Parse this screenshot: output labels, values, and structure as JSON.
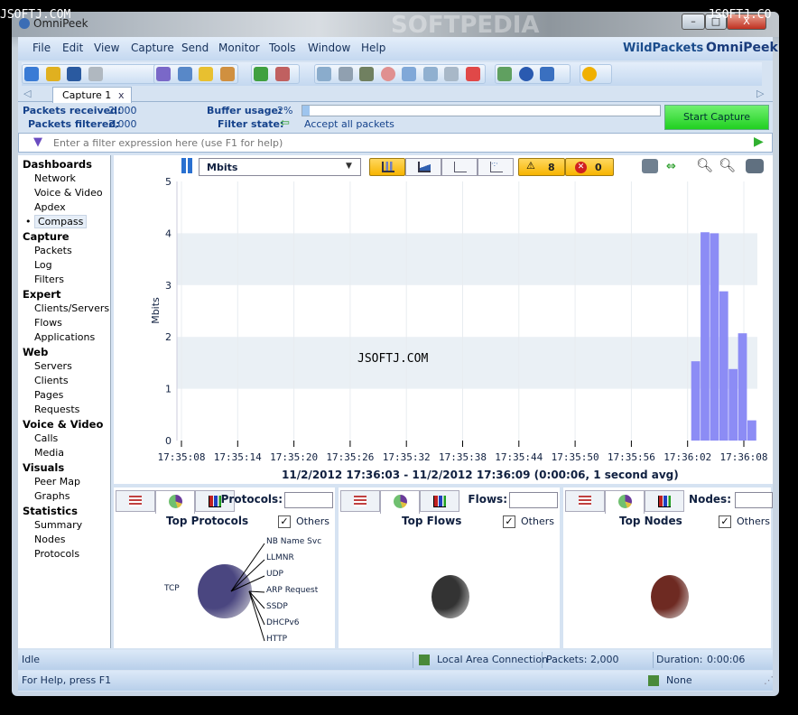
{
  "watermarks": {
    "left": "JSOFTJ.COM",
    "right": "JSOFTJ.CO",
    "center": "JSOFTJ.COM",
    "softpedia": "SOFTPEDIA"
  },
  "window": {
    "title": "OmniPeek",
    "minimize": "–",
    "maximize": "□",
    "close": "X"
  },
  "menu": [
    "File",
    "Edit",
    "View",
    "Capture",
    "Send",
    "Monitor",
    "Tools",
    "Window",
    "Help"
  ],
  "brand": {
    "wild": "WildPackets",
    "omni": "OmniPeek"
  },
  "tab": {
    "label": "Capture 1",
    "close": "x"
  },
  "info": {
    "packets_received_label": "Packets received:",
    "packets_received": "2,000",
    "packets_filtered_label": "Packets filtered:",
    "packets_filtered": "2,000",
    "buffer_usage_label": "Buffer usage:",
    "buffer_usage": "2%",
    "buffer_fraction": 0.02,
    "filter_state_label": "Filter state:",
    "filter_state": "Accept all packets",
    "start_capture": "Start Capture"
  },
  "filter": {
    "placeholder": "Enter a filter expression here (use F1 for help)"
  },
  "sidebar": [
    {
      "header": "Dashboards",
      "items": [
        "Network",
        "Voice & Video",
        "Apdex",
        "Compass"
      ]
    },
    {
      "header": "Capture",
      "items": [
        "Packets",
        "Log",
        "Filters"
      ]
    },
    {
      "header": "Expert",
      "items": [
        "Clients/Servers",
        "Flows",
        "Applications"
      ]
    },
    {
      "header": "Web",
      "items": [
        "Servers",
        "Clients",
        "Pages",
        "Requests"
      ]
    },
    {
      "header": "Voice & Video",
      "items": [
        "Calls",
        "Media"
      ]
    },
    {
      "header": "Visuals",
      "items": [
        "Peer Map",
        "Graphs"
      ]
    },
    {
      "header": "Statistics",
      "items": [
        "Summary",
        "Nodes",
        "Protocols"
      ]
    }
  ],
  "sidebar_selected": "Compass",
  "chart_toolbar": {
    "unit_select": "Mbits",
    "warnings": "8",
    "errors": "0"
  },
  "chart_data": {
    "type": "bar",
    "ylabel": "Mbits",
    "ylim": [
      0,
      5
    ],
    "yticks": [
      "0",
      "1",
      "2",
      "3",
      "4",
      "5"
    ],
    "xticks": [
      "17:35:08",
      "17:35:14",
      "17:35:20",
      "17:35:26",
      "17:35:32",
      "17:35:38",
      "17:35:44",
      "17:35:50",
      "17:35:56",
      "17:36:02",
      "17:36:08"
    ],
    "categories": [
      "17:36:02",
      "17:36:03",
      "17:36:04",
      "17:36:05",
      "17:36:06",
      "17:36:07",
      "17:36:08"
    ],
    "values": [
      1.53,
      4.02,
      4.0,
      2.88,
      1.38,
      2.07,
      0.39
    ],
    "bar_color": "#8c8cf5",
    "grid": true
  },
  "chart_caption": "11/2/2012 17:36:03 - 11/2/2012 17:36:09  (0:00:06, 1 second avg)",
  "panels": [
    {
      "filter_label": "Protocols:",
      "title": "Top Protocols",
      "others": "Others",
      "labels": [
        "NB Name Svc",
        "LLMNR",
        "UDP",
        "ARP Request",
        "SSDP",
        "DHCPv6",
        "HTTP"
      ],
      "main_label": "TCP",
      "pie_color": "#4a4680"
    },
    {
      "filter_label": "Flows:",
      "title": "Top Flows",
      "others": "Others",
      "labels": [],
      "main_label": "",
      "pie_color": "#333333"
    },
    {
      "filter_label": "Nodes:",
      "title": "Top Nodes",
      "others": "Others",
      "labels": [],
      "main_label": "",
      "pie_color": "#6e2a22"
    }
  ],
  "status": {
    "state": "Idle",
    "adapter": "Local Area Connection",
    "packets_label": "Packets:",
    "packets": "2,000",
    "duration_label": "Duration:",
    "duration": "0:00:06",
    "help": "For Help, press F1",
    "adapter2": "None"
  }
}
